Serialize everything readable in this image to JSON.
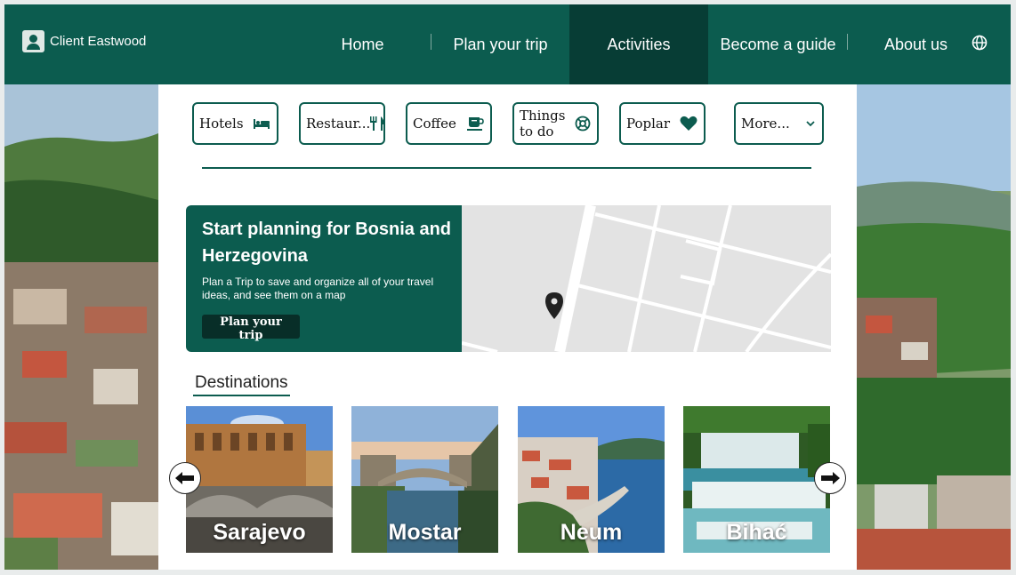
{
  "header": {
    "user_name": "Client Eastwood",
    "nav": [
      {
        "label": "Home",
        "active": false
      },
      {
        "label": "Plan your trip",
        "active": false
      },
      {
        "label": "Activities",
        "active": true
      },
      {
        "label": "Become a guide",
        "active": false
      },
      {
        "label": "About us",
        "active": false
      }
    ],
    "language_icon": "globe-icon"
  },
  "categories": [
    {
      "label": "Hotels",
      "icon": "bed-icon"
    },
    {
      "label": "Restaur...",
      "icon": "fork-knife-icon"
    },
    {
      "label": "Coffee",
      "icon": "coffee-cup-icon"
    },
    {
      "label": "Things to do",
      "icon": "ticket-icon"
    },
    {
      "label": "Poplar",
      "icon": "heart-icon"
    },
    {
      "label": "More...",
      "icon": "chevron-down-icon"
    }
  ],
  "promo": {
    "title": "Start planning for Bosnia and Herzegovina",
    "description": "Plan a Trip to save and organize all of your travel ideas, and see them on a map",
    "button": "Plan your trip"
  },
  "destinations": {
    "title": "Destinations",
    "items": [
      {
        "name": "Sarajevo"
      },
      {
        "name": "Mostar"
      },
      {
        "name": "Neum"
      },
      {
        "name": "Bihać"
      }
    ]
  },
  "colors": {
    "brand": "#0c5c4f",
    "brand_dark": "#073d35"
  }
}
